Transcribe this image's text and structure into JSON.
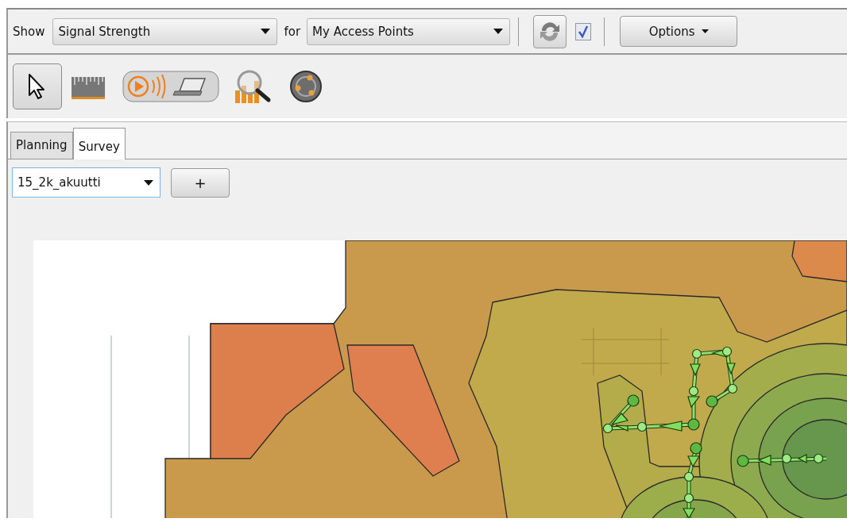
{
  "toolbar": {
    "show_label": "Show",
    "show_select": {
      "value": "Signal Strength"
    },
    "for_label": "for",
    "for_select": {
      "value": "My Access Points"
    },
    "auto_refresh": {
      "checked": true
    },
    "options_button": "Options"
  },
  "tools": [
    {
      "kind": "pointer",
      "selected": true
    },
    {
      "kind": "ruler",
      "selected": false
    },
    {
      "kind": "survey",
      "selected": false
    },
    {
      "kind": "analyze",
      "selected": false
    },
    {
      "kind": "globe",
      "selected": false
    }
  ],
  "tabs": [
    {
      "label": "Planning",
      "selected": false
    },
    {
      "label": "Survey",
      "selected": true
    }
  ],
  "floor": {
    "select": {
      "value": "15_2k_akuutti"
    },
    "add_button": "+"
  }
}
